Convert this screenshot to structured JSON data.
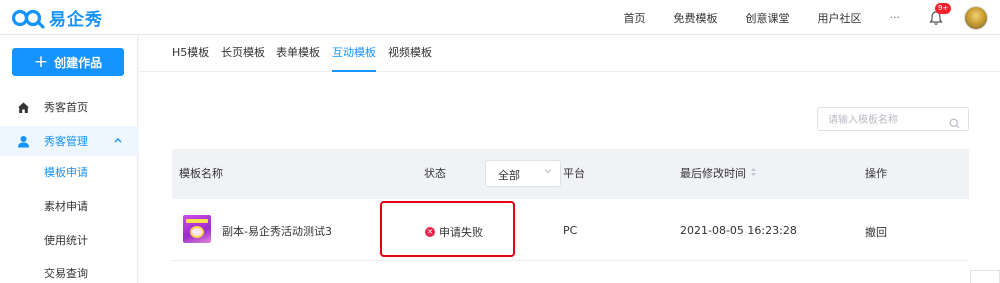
{
  "brand": {
    "name": "易企秀",
    "color": "#1593ff"
  },
  "topnav": {
    "items": [
      "首页",
      "免费模板",
      "创意课堂",
      "用户社区"
    ],
    "more": "···",
    "notification_badge": "9+"
  },
  "sidebar": {
    "create_button": "创建作品",
    "items": [
      {
        "label": "秀客首页",
        "icon": "home-icon"
      },
      {
        "label": "秀客管理",
        "icon": "user-icon",
        "expanded": true
      }
    ],
    "sub_items": [
      "模板申请",
      "素材申请",
      "使用统计",
      "交易查询"
    ],
    "current_sub": "模板申请"
  },
  "tabs": {
    "items": [
      "H5模板",
      "长页模板",
      "表单模板",
      "互动模板",
      "视频模板"
    ],
    "active": "互动模板"
  },
  "search": {
    "placeholder": "请输入模板名称",
    "value": ""
  },
  "table": {
    "headers": {
      "name": "模板名称",
      "status": "状态",
      "status_filter": "全部",
      "platform": "平台",
      "modified": "最后修改时间",
      "action": "操作"
    },
    "rows": [
      {
        "name": "副本-易企秀活动测试3",
        "status": "申请失败",
        "platform": "PC",
        "modified": "2021-08-05 16:23:28",
        "action": "撤回"
      }
    ]
  },
  "colors": {
    "accent": "#1593ff",
    "fail": "#e8264a",
    "highlight_box": "#e60012"
  }
}
